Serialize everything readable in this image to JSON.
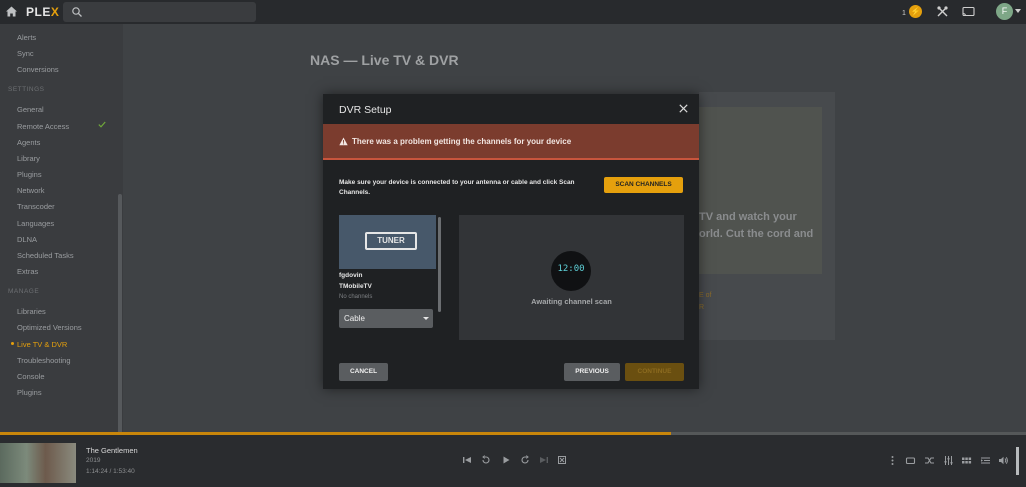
{
  "app": {
    "logo_main": "PLE",
    "logo_accent": "X"
  },
  "topbar": {
    "badge_count": "1",
    "avatar_initial": "F"
  },
  "sidebar": {
    "items_top": [
      "Alerts",
      "Sync",
      "Conversions"
    ],
    "settings_heading": "SETTINGS",
    "settings_items": [
      "General",
      "Remote Access",
      "Agents",
      "Library",
      "Plugins",
      "Network",
      "Transcoder",
      "Languages",
      "DLNA",
      "Scheduled Tasks",
      "Extras"
    ],
    "manage_heading": "MANAGE",
    "manage_items": [
      "Libraries",
      "Optimized Versions",
      "Live TV & DVR",
      "Troubleshooting",
      "Console",
      "Plugins"
    ]
  },
  "main": {
    "page_title": "NAS — Live TV & DVR",
    "bg_text_1": "TV and watch your",
    "bg_text_2": "orld. Cut the cord and",
    "bg_small_1": "E of",
    "bg_small_2": "R"
  },
  "modal": {
    "title": "DVR Setup",
    "alert": "There was a problem getting the channels for your device",
    "instructions": "Make sure your device is connected to your antenna or cable and click Scan Channels.",
    "scan_button": "SCAN CHANNELS",
    "tuner_label": "TUNER",
    "device_name": "fgdovin",
    "device_model": "TMobileTV",
    "device_status": "No channels",
    "source_select": {
      "value": "Cable"
    },
    "clock": "12:00",
    "awaiting": "Awaiting channel scan",
    "cancel_button": "CANCEL",
    "previous_button": "PREVIOUS",
    "continue_button": "CONTINUE"
  },
  "player": {
    "title": "The Gentlemen",
    "year": "2019",
    "time": "1:14:24 / 1:53:40",
    "progress_fraction": 0.654
  },
  "colors": {
    "accent": "#e5a00d",
    "alert_bg": "#7b3c2e",
    "clock_digits": "#5ed1d8"
  }
}
